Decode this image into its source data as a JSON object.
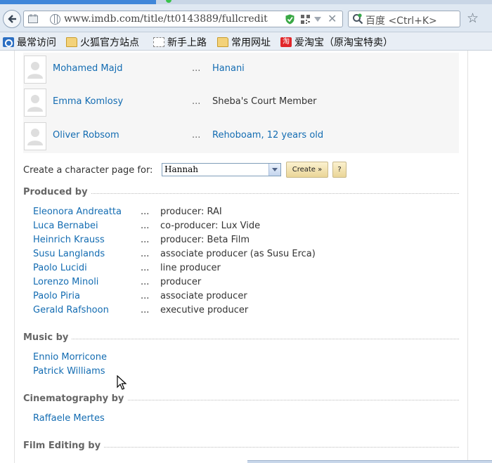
{
  "browser": {
    "url": "www.imdb.com/title/tt0143889/fullcredit",
    "search_placeholder": "百度 <Ctrl+K>",
    "bookmarks": [
      "最常访问",
      "火狐官方站点",
      "新手上路",
      "常用网址",
      "爱淘宝（原淘宝特卖）"
    ]
  },
  "cast": [
    {
      "actor": "Mohamed Majd",
      "dots": "...",
      "character": "Hanani",
      "character_is_link": true
    },
    {
      "actor": "Emma Komlosy",
      "dots": "...",
      "character": "Sheba's Court Member",
      "character_is_link": false
    },
    {
      "actor": "Oliver Robsom",
      "dots": "...",
      "character": "Rehoboam, 12 years old",
      "character_is_link": true
    }
  ],
  "character_page": {
    "label": "Create a character page for:",
    "selected": "Hannah",
    "create_label": "Create »",
    "help_label": "?"
  },
  "sections": {
    "produced_by": {
      "title": "Produced by",
      "credits": [
        {
          "name": "Eleonora Andreatta",
          "role": "producer: RAI"
        },
        {
          "name": "Luca Bernabei",
          "role": "co-producer: Lux Vide"
        },
        {
          "name": "Heinrich Krauss",
          "role": "producer: Beta Film"
        },
        {
          "name": "Susu Langlands",
          "role": "associate producer (as Susu Erca)"
        },
        {
          "name": "Paolo Lucidi",
          "role": "line producer"
        },
        {
          "name": "Lorenzo Minoli",
          "role": "producer"
        },
        {
          "name": "Paolo Piria",
          "role": "associate producer"
        },
        {
          "name": "Gerald Rafshoon",
          "role": "executive producer"
        }
      ]
    },
    "music_by": {
      "title": "Music by",
      "credits": [
        {
          "name": "Ennio Morricone",
          "role": ""
        },
        {
          "name": "Patrick Williams",
          "role": ""
        }
      ]
    },
    "cinematography_by": {
      "title": "Cinematography by",
      "credits": [
        {
          "name": "Raffaele Mertes",
          "role": ""
        }
      ]
    },
    "film_editing_by": {
      "title": "Film Editing by",
      "credits": []
    }
  },
  "credit_dots": "...",
  "colors": {
    "link": "#136cb2",
    "section_title": "#666666",
    "button": "#ead597"
  }
}
